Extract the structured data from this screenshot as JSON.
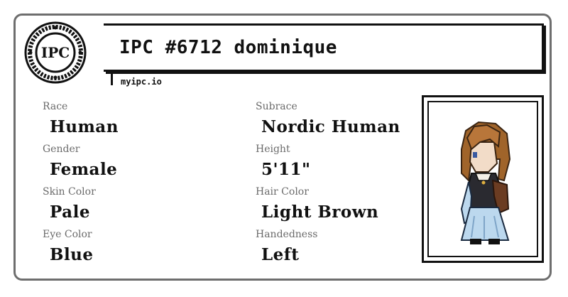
{
  "brand": {
    "logo_text": "IPC",
    "site": "myipc.io"
  },
  "title": "IPC #6712 dominique",
  "fields": [
    {
      "label": "Race",
      "value": "Human"
    },
    {
      "label": "Subrace",
      "value": "Nordic Human"
    },
    {
      "label": "Gender",
      "value": "Female"
    },
    {
      "label": "Height",
      "value": "5'11\""
    },
    {
      "label": "Skin Color",
      "value": "Pale"
    },
    {
      "label": "Hair Color",
      "value": "Light Brown"
    },
    {
      "label": "Eye Color",
      "value": "Blue"
    },
    {
      "label": "Handedness",
      "value": "Left"
    }
  ],
  "portrait": {
    "icon": "character-sprite-icon",
    "hair_color": "#a0642a",
    "skin_color": "#f2dcc8",
    "dress_color": "#bcd8ee"
  },
  "colors": {
    "border": "#6e6e6e",
    "ink": "#111111",
    "label": "#6a6a6a"
  }
}
